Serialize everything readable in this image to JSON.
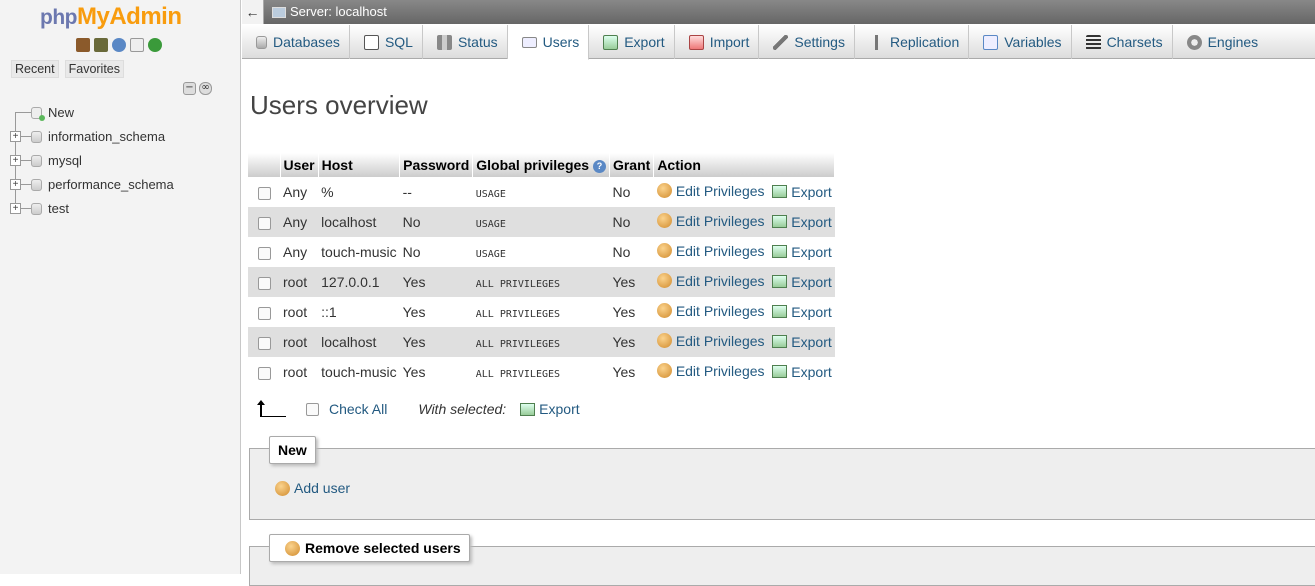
{
  "nav": {
    "logo": {
      "php": "php",
      "my": "My",
      "admin": "Admin"
    },
    "recent_label": "Recent",
    "favorites_label": "Favorites",
    "tree": [
      {
        "label": "New"
      },
      {
        "label": "information_schema"
      },
      {
        "label": "mysql"
      },
      {
        "label": "performance_schema"
      },
      {
        "label": "test"
      }
    ]
  },
  "serverbar": {
    "label": "Server: localhost"
  },
  "tabs": [
    {
      "label": "Databases",
      "icon": "databases-icon"
    },
    {
      "label": "SQL",
      "icon": "sql-icon"
    },
    {
      "label": "Status",
      "icon": "status-icon"
    },
    {
      "label": "Users",
      "icon": "users-icon"
    },
    {
      "label": "Export",
      "icon": "export-icon"
    },
    {
      "label": "Import",
      "icon": "import-icon"
    },
    {
      "label": "Settings",
      "icon": "settings-icon"
    },
    {
      "label": "Replication",
      "icon": "replication-icon"
    },
    {
      "label": "Variables",
      "icon": "variables-icon"
    },
    {
      "label": "Charsets",
      "icon": "charsets-icon"
    },
    {
      "label": "Engines",
      "icon": "engines-icon"
    }
  ],
  "main": {
    "title": "Users overview",
    "table": {
      "headers": {
        "user": "User",
        "host": "Host",
        "password": "Password",
        "global": "Global privileges",
        "grant": "Grant",
        "action": "Action"
      },
      "rows": [
        {
          "user": "Any",
          "host": "%",
          "password": "--",
          "privileges": "USAGE",
          "grant": "No",
          "edit": "Edit Privileges",
          "export": "Export"
        },
        {
          "user": "Any",
          "host": "localhost",
          "password": "No",
          "privileges": "USAGE",
          "grant": "No",
          "edit": "Edit Privileges",
          "export": "Export"
        },
        {
          "user": "Any",
          "host": "touch-music",
          "password": "No",
          "privileges": "USAGE",
          "grant": "No",
          "edit": "Edit Privileges",
          "export": "Export"
        },
        {
          "user": "root",
          "host": "127.0.0.1",
          "password": "Yes",
          "privileges": "ALL PRIVILEGES",
          "grant": "Yes",
          "edit": "Edit Privileges",
          "export": "Export"
        },
        {
          "user": "root",
          "host": "::1",
          "password": "Yes",
          "privileges": "ALL PRIVILEGES",
          "grant": "Yes",
          "edit": "Edit Privileges",
          "export": "Export"
        },
        {
          "user": "root",
          "host": "localhost",
          "password": "Yes",
          "privileges": "ALL PRIVILEGES",
          "grant": "Yes",
          "edit": "Edit Privileges",
          "export": "Export"
        },
        {
          "user": "root",
          "host": "touch-music",
          "password": "Yes",
          "privileges": "ALL PRIVILEGES",
          "grant": "Yes",
          "edit": "Edit Privileges",
          "export": "Export"
        }
      ]
    },
    "check_all": "Check All",
    "with_selected": "With selected:",
    "bulk_export": "Export",
    "new_legend": "New",
    "add_user": "Add user",
    "remove_legend": "Remove selected users"
  },
  "colors": {
    "link": "#235a81",
    "red": "#e00000",
    "logo_orange": "#f89c0e",
    "logo_blue": "#6c78af"
  }
}
